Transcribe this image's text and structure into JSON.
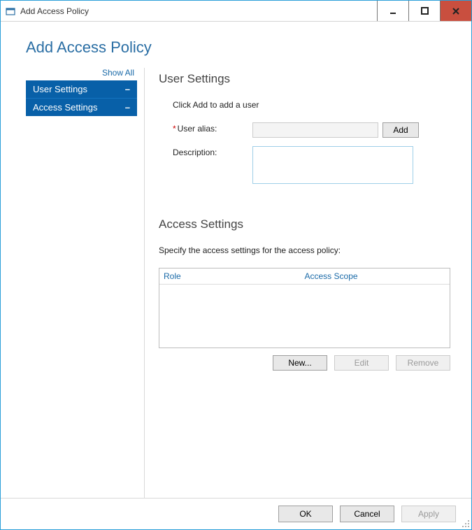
{
  "window": {
    "title": "Add Access Policy"
  },
  "page": {
    "title": "Add Access Policy"
  },
  "sidebar": {
    "show_all": "Show All",
    "items": [
      {
        "label": "User Settings"
      },
      {
        "label": "Access Settings"
      }
    ]
  },
  "user_settings": {
    "title": "User Settings",
    "instruction": "Click Add to add a user",
    "alias_label": "User alias:",
    "alias_value": "",
    "add_button": "Add",
    "description_label": "Description:",
    "description_value": ""
  },
  "access_settings": {
    "title": "Access Settings",
    "instruction": "Specify the access settings for the access policy:",
    "columns": {
      "role": "Role",
      "scope": "Access Scope"
    },
    "buttons": {
      "new": "New...",
      "edit": "Edit",
      "remove": "Remove"
    }
  },
  "footer": {
    "ok": "OK",
    "cancel": "Cancel",
    "apply": "Apply"
  }
}
